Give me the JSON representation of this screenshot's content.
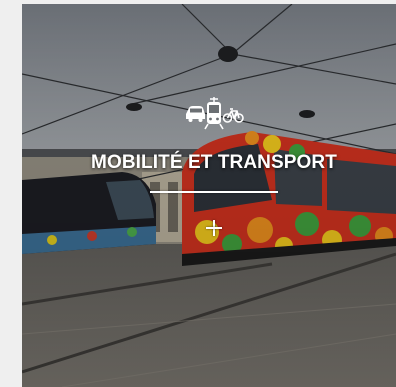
{
  "tile": {
    "title": "MOBILITÉ ET TRANSPORT",
    "icons": [
      "car-icon",
      "tram-icon",
      "bicycle-icon"
    ],
    "expand_icon": "plus-icon",
    "colors": {
      "text": "#ffffff",
      "sky": "#8a8f96",
      "pavement": "#6e6a64"
    }
  }
}
